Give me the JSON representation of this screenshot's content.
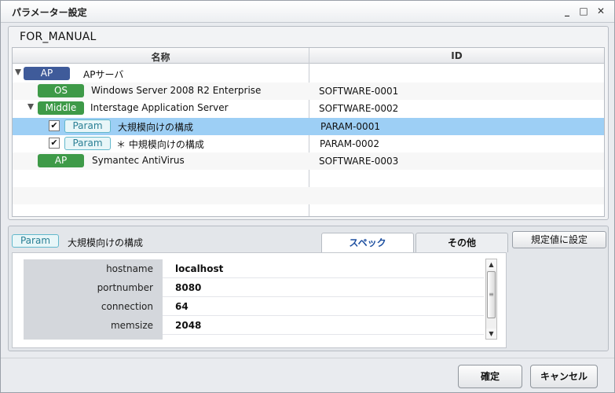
{
  "window": {
    "title": "パラメーター設定"
  },
  "upper": {
    "title": "FOR_MANUAL",
    "columns": {
      "name": "名称",
      "id": "ID"
    },
    "rows": [
      {
        "badge": "AP",
        "name": "APサーバ",
        "id": ""
      },
      {
        "badge": "OS",
        "name": "Windows Server 2008 R2 Enterprise",
        "id": "SOFTWARE-0001"
      },
      {
        "badge": "Middle",
        "name": "Interstage Application Server",
        "id": "SOFTWARE-0002"
      },
      {
        "badge": "Param",
        "name": "大規模向けの構成",
        "id": "PARAM-0001"
      },
      {
        "badge": "Param",
        "name": "＊ 中規模向けの構成",
        "id": "PARAM-0002"
      },
      {
        "badge": "AP",
        "name": "Symantec AntiVirus",
        "id": "SOFTWARE-0003"
      }
    ]
  },
  "lower": {
    "param_badge": "Param",
    "title": "大規模向けの構成",
    "tabs": {
      "spec": "スペック",
      "other": "その他"
    },
    "set_defaults": "規定値に設定",
    "specs": [
      {
        "key": "hostname",
        "value": "localhost"
      },
      {
        "key": "portnumber",
        "value": "8080"
      },
      {
        "key": "connection",
        "value": "64"
      },
      {
        "key": "memsize",
        "value": "2048"
      }
    ]
  },
  "footer": {
    "ok": "確定",
    "cancel": "キャンセル"
  },
  "colors": {
    "selected_row": "#9dcff5",
    "badge_green": "#3e9a48",
    "badge_ap_root": "#3f5b9a",
    "param_border": "#62b8cc"
  }
}
